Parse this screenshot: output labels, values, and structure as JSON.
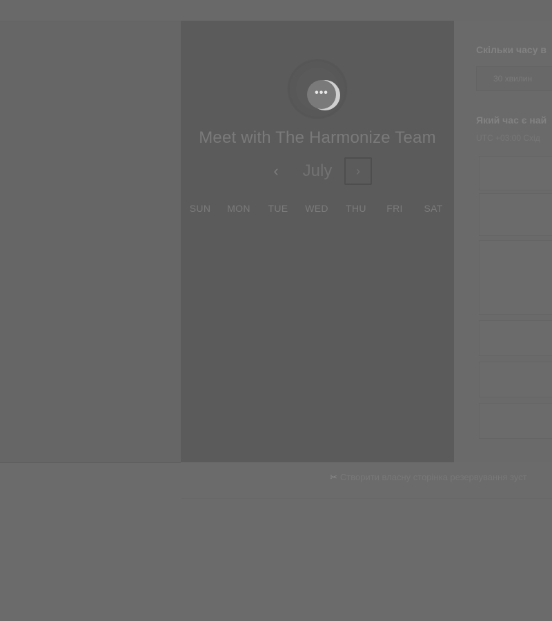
{
  "calendar": {
    "title": "Meet with The Harmonize Team",
    "month": "July",
    "prev_label": "‹",
    "next_label": "›",
    "weekdays": [
      "SUN",
      "MON",
      "TUE",
      "WED",
      "THU",
      "FRI",
      "SAT"
    ],
    "avatar_dots": "•••"
  },
  "booking": {
    "duration_question": "Скільки часу в",
    "duration_option": "30 хвилин",
    "time_question": "Який час є най",
    "timezone": "UTC +03:00 Схід"
  },
  "footer": {
    "link_icon": "✂",
    "link_text": "Створити власну сторінка резервування зуст"
  }
}
